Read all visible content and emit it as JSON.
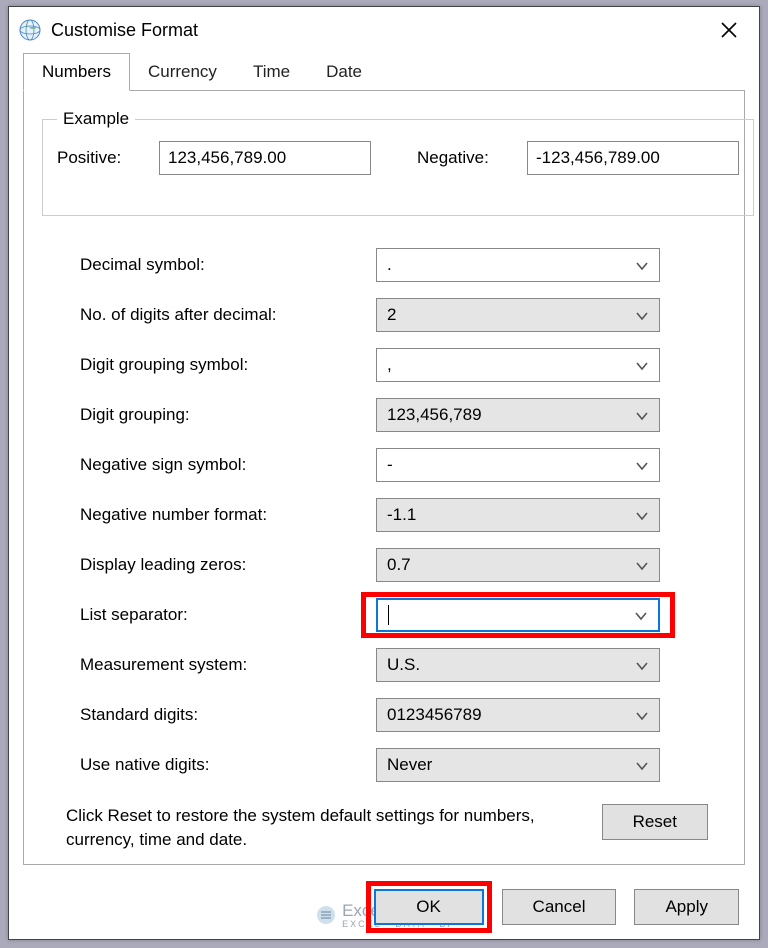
{
  "window": {
    "title": "Customise Format"
  },
  "tabs": {
    "numbers": "Numbers",
    "currency": "Currency",
    "time": "Time",
    "date": "Date",
    "active": "numbers"
  },
  "example": {
    "legend": "Example",
    "positive_label": "Positive:",
    "positive_value": "123,456,789.00",
    "negative_label": "Negative:",
    "negative_value": "-123,456,789.00"
  },
  "fields": {
    "decimal_symbol": {
      "label": "Decimal symbol:",
      "value": ".",
      "style": "white"
    },
    "digits_after": {
      "label": "No. of digits after decimal:",
      "value": "2",
      "style": "grey"
    },
    "group_symbol": {
      "label": "Digit grouping symbol:",
      "value": ",",
      "style": "white"
    },
    "grouping": {
      "label": "Digit grouping:",
      "value": "123,456,789",
      "style": "grey"
    },
    "neg_sign": {
      "label": "Negative sign symbol:",
      "value": "-",
      "style": "white"
    },
    "neg_format": {
      "label": "Negative number format:",
      "value": "-1.1",
      "style": "grey"
    },
    "leading_zeros": {
      "label": "Display leading zeros:",
      "value": "0.7",
      "style": "grey"
    },
    "list_separator": {
      "label": "List separator:",
      "value": "|",
      "style": "focus"
    },
    "measurement": {
      "label": "Measurement system:",
      "value": "U.S.",
      "style": "grey"
    },
    "standard_digits": {
      "label": "Standard digits:",
      "value": "0123456789",
      "style": "grey"
    },
    "native_digits": {
      "label": "Use native digits:",
      "value": "Never",
      "style": "grey"
    }
  },
  "reset": {
    "text": "Click Reset to restore the system default settings for numbers, currency, time and date.",
    "button": "Reset"
  },
  "buttons": {
    "ok": "OK",
    "cancel": "Cancel",
    "apply": "Apply"
  },
  "watermark": {
    "brand": "Exceldemy",
    "sub": "EXCEL · DATA · BI"
  }
}
